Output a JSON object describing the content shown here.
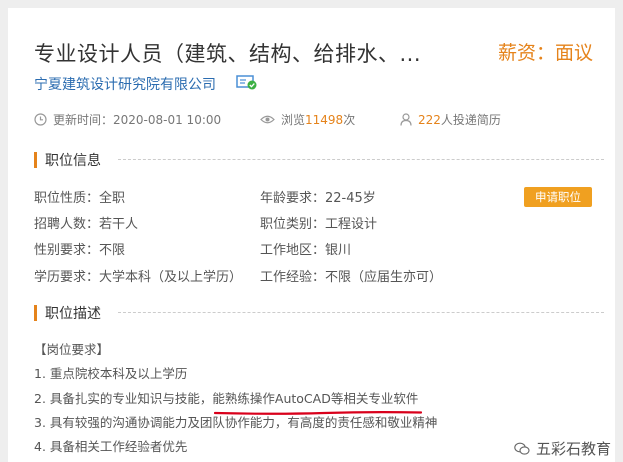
{
  "job": {
    "title": "专业设计人员（建筑、结构、给排水、...",
    "salary": "薪资：面议",
    "company": "宁夏建筑设计研究院有限公司"
  },
  "meta": {
    "update_label": "更新时间：2020-08-01 10:00",
    "views_prefix": "浏览",
    "views_count": "11498",
    "views_suffix": "次",
    "applicants_count": "222",
    "applicants_suffix": "人投递简历"
  },
  "info_section": {
    "heading": "职位信息",
    "apply_button": "申请职位",
    "rows": [
      {
        "left": "职位性质：全职",
        "right": "年龄要求：22-45岁"
      },
      {
        "left": "招聘人数：若干人",
        "right": "职位类别：工程设计"
      },
      {
        "left": "性别要求：不限",
        "right": "工作地区：银川"
      },
      {
        "left": "学历要求：大学本科（及以上学历）",
        "right": "工作经验：不限（应届生亦可）"
      }
    ]
  },
  "desc_section": {
    "heading": "职位描述",
    "lines": [
      "【岗位要求】",
      "1. 重点院校本科及以上学历",
      "2. 具备扎实的专业知识与技能，能熟练操作AutoCAD等相关专业软件",
      "3. 具有较强的沟通协调能力及团队协作能力，有高度的责任感和敬业精神",
      "4. 具备相关工作经验者优先"
    ]
  },
  "watermark": "五彩石教育",
  "colors": {
    "accent": "#e5831b",
    "link": "#2b6cb0",
    "underline": "#d9001b"
  }
}
